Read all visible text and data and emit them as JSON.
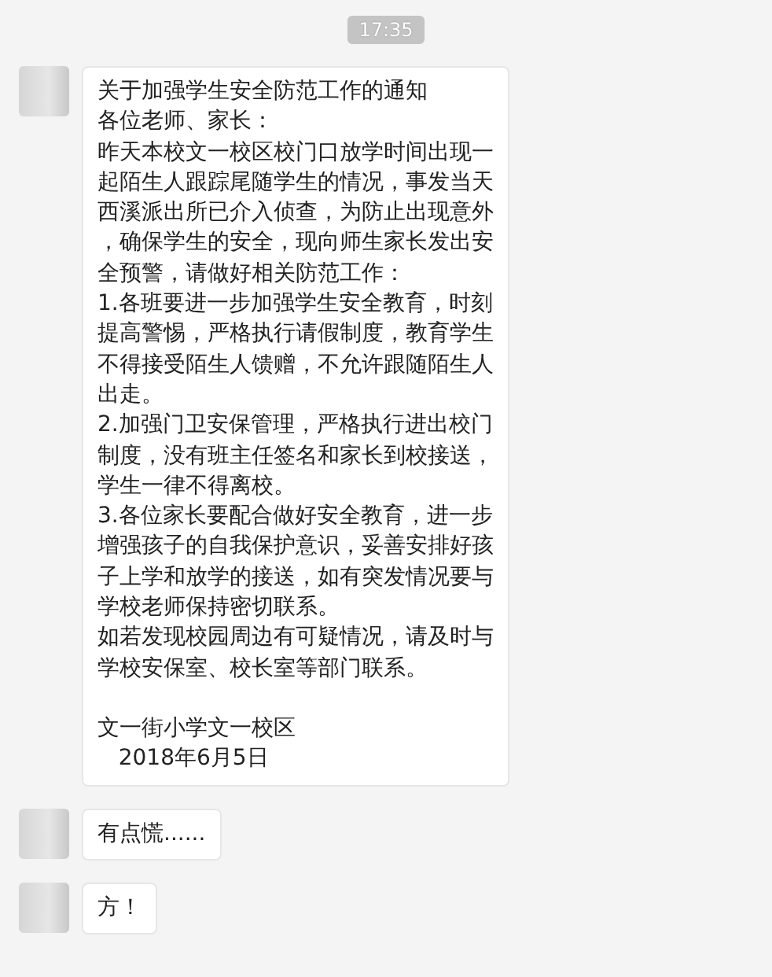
{
  "time_label": "17:35",
  "messages": [
    {
      "blocks": [
        [
          "关于加强学生安全防范工作的通知",
          "各位老师、家长：",
          "昨天本校文一校区校门口放学时间出现一",
          "起陌生人跟踪尾随学生的情况，事发当天",
          "西溪派出所已介入侦查，为防止出现意外",
          "，确保学生的安全，现向师生家长发出安",
          "全预警，请做好相关防范工作：",
          "1.各班要进一步加强学生安全教育，时刻",
          "提高警惕，严格执行请假制度，教育学生",
          "不得接受陌生人馈赠，不允许跟随陌生人",
          "出走。",
          "2.加强门卫安保管理，严格执行进出校门",
          "制度，没有班主任签名和家长到校接送，",
          "学生一律不得离校。",
          "3.各位家长要配合做好安全教育，进一步",
          "增强孩子的自我保护意识，妥善安排好孩",
          "子上学和放学的接送，如有突发情况要与",
          "学校老师保持密切联系。",
          "如若发现校园周边有可疑情况，请及时与",
          "学校安保室、校长室等部门联系。"
        ],
        [
          "文一街小学文一校区",
          "   2018年6月5日"
        ]
      ]
    },
    {
      "blocks": [
        [
          "有点慌......"
        ]
      ]
    },
    {
      "blocks": [
        [
          "方！"
        ]
      ]
    }
  ]
}
